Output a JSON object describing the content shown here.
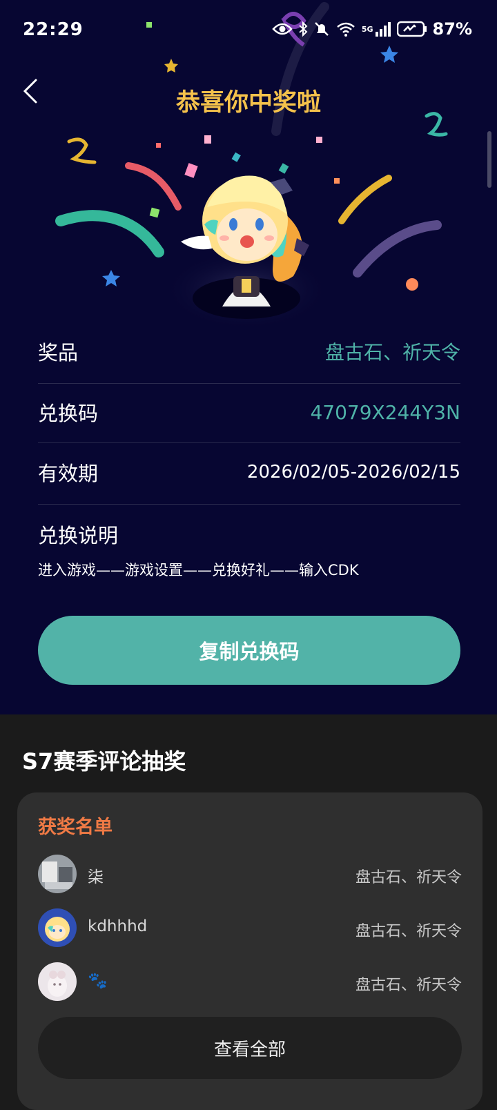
{
  "status_bar": {
    "time": "22:29",
    "battery": "87%",
    "network": "5G"
  },
  "header": {
    "title": "恭喜你中奖啦"
  },
  "prize": {
    "label": "奖品",
    "value": "盘古石、祈天令"
  },
  "code": {
    "label": "兑换码",
    "value": "47079X244Y3N"
  },
  "validity": {
    "label": "有效期",
    "value": "2026/02/05-2026/02/15"
  },
  "instructions": {
    "label": "兑换说明",
    "text": "进入游戏——游戏设置——兑换好礼——输入CDK"
  },
  "copy_button": {
    "label": "复制兑换码"
  },
  "season": {
    "title": "S7赛季评论抽奖"
  },
  "winners": {
    "title": "获奖名单",
    "items": [
      {
        "name": "柒",
        "prize": "盘古石、祈天令"
      },
      {
        "name": "kdhhhd",
        "prize": "盘古石、祈天令"
      },
      {
        "name": "🐾",
        "prize": "盘古石、祈天令"
      }
    ],
    "view_all": "查看全部"
  },
  "colors": {
    "accent": "#52b3a8",
    "title": "#f5c24b",
    "winner_title": "#f07a45",
    "background": "#070632"
  }
}
